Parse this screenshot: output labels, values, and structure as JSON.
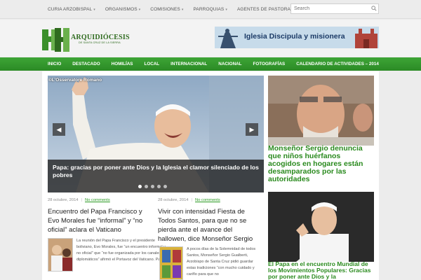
{
  "topnav": {
    "items": [
      "CURIA ARZOBISPAL",
      "ORGANISMOS",
      "COMISIONES",
      "PARROQUIAS",
      "AGENTES DE PASTORAL"
    ],
    "search_placeholder": "Search"
  },
  "logo": {
    "title": "ARQUIDIÓCESIS",
    "subtitle": "DE SANTA CRUZ DE LA SIERRA"
  },
  "banner": {
    "text": "Iglesia Discipula y misionera"
  },
  "mainnav": [
    "INICIO",
    "DESTACADO",
    "HOMILÍAS",
    "LOCAL",
    "INTERNACIONAL",
    "NACIONAL",
    "FOTOGRAFÍAS",
    "CALENDARIO DE ACTIVIDADES – 2014"
  ],
  "slider": {
    "credit": "©L'Osservatore Romano",
    "caption": "Papa: gracias por poner ante Dios y la Iglesia el clamor silenciado de los pobres",
    "prev": "◀",
    "next": "▶",
    "slide_count": 5,
    "active_slide": 1
  },
  "articles": [
    {
      "date": "28 octubre, 2014",
      "comments": "No comments",
      "title": "Encuentro del Papa Francisco y Evo Morales fue “informal” y “no oficial” aclara el Vaticano",
      "excerpt": "La reunión del Papa Francisco y el presidente boliviano, Evo Morales, fue “un encuentro informal y no oficial” que “no fue organizada por los canales diplomáticos” afirmó el Portavoz del Vaticano. Padre"
    },
    {
      "date": "28 octubre, 2014",
      "comments": "No comments",
      "title": "Vivir con intensidad Fiesta de Todos Santos, para que no se pierda ante el avance del hallowen, dice Monseñor Sergio",
      "excerpt": "A pocos días de la Solemnidad de todos Santos, Monseñor Sergio Gualberti, Arzobispo de Santa Cruz pidió guardar estas tradiciones “con mucho cuidado y cariño para que no"
    }
  ],
  "sidebar": [
    {
      "title": "Monseñor Sergio denuncia que niños huérfanos acogidos en hogares están desamparados por las autoridades"
    },
    {
      "title": "El Papa en el encuentro Mundial de los Movimientos Populares: Gracias por poner ante Dios y la"
    }
  ],
  "colors": {
    "accent": "#2b8a25",
    "link": "#2a9a22"
  }
}
